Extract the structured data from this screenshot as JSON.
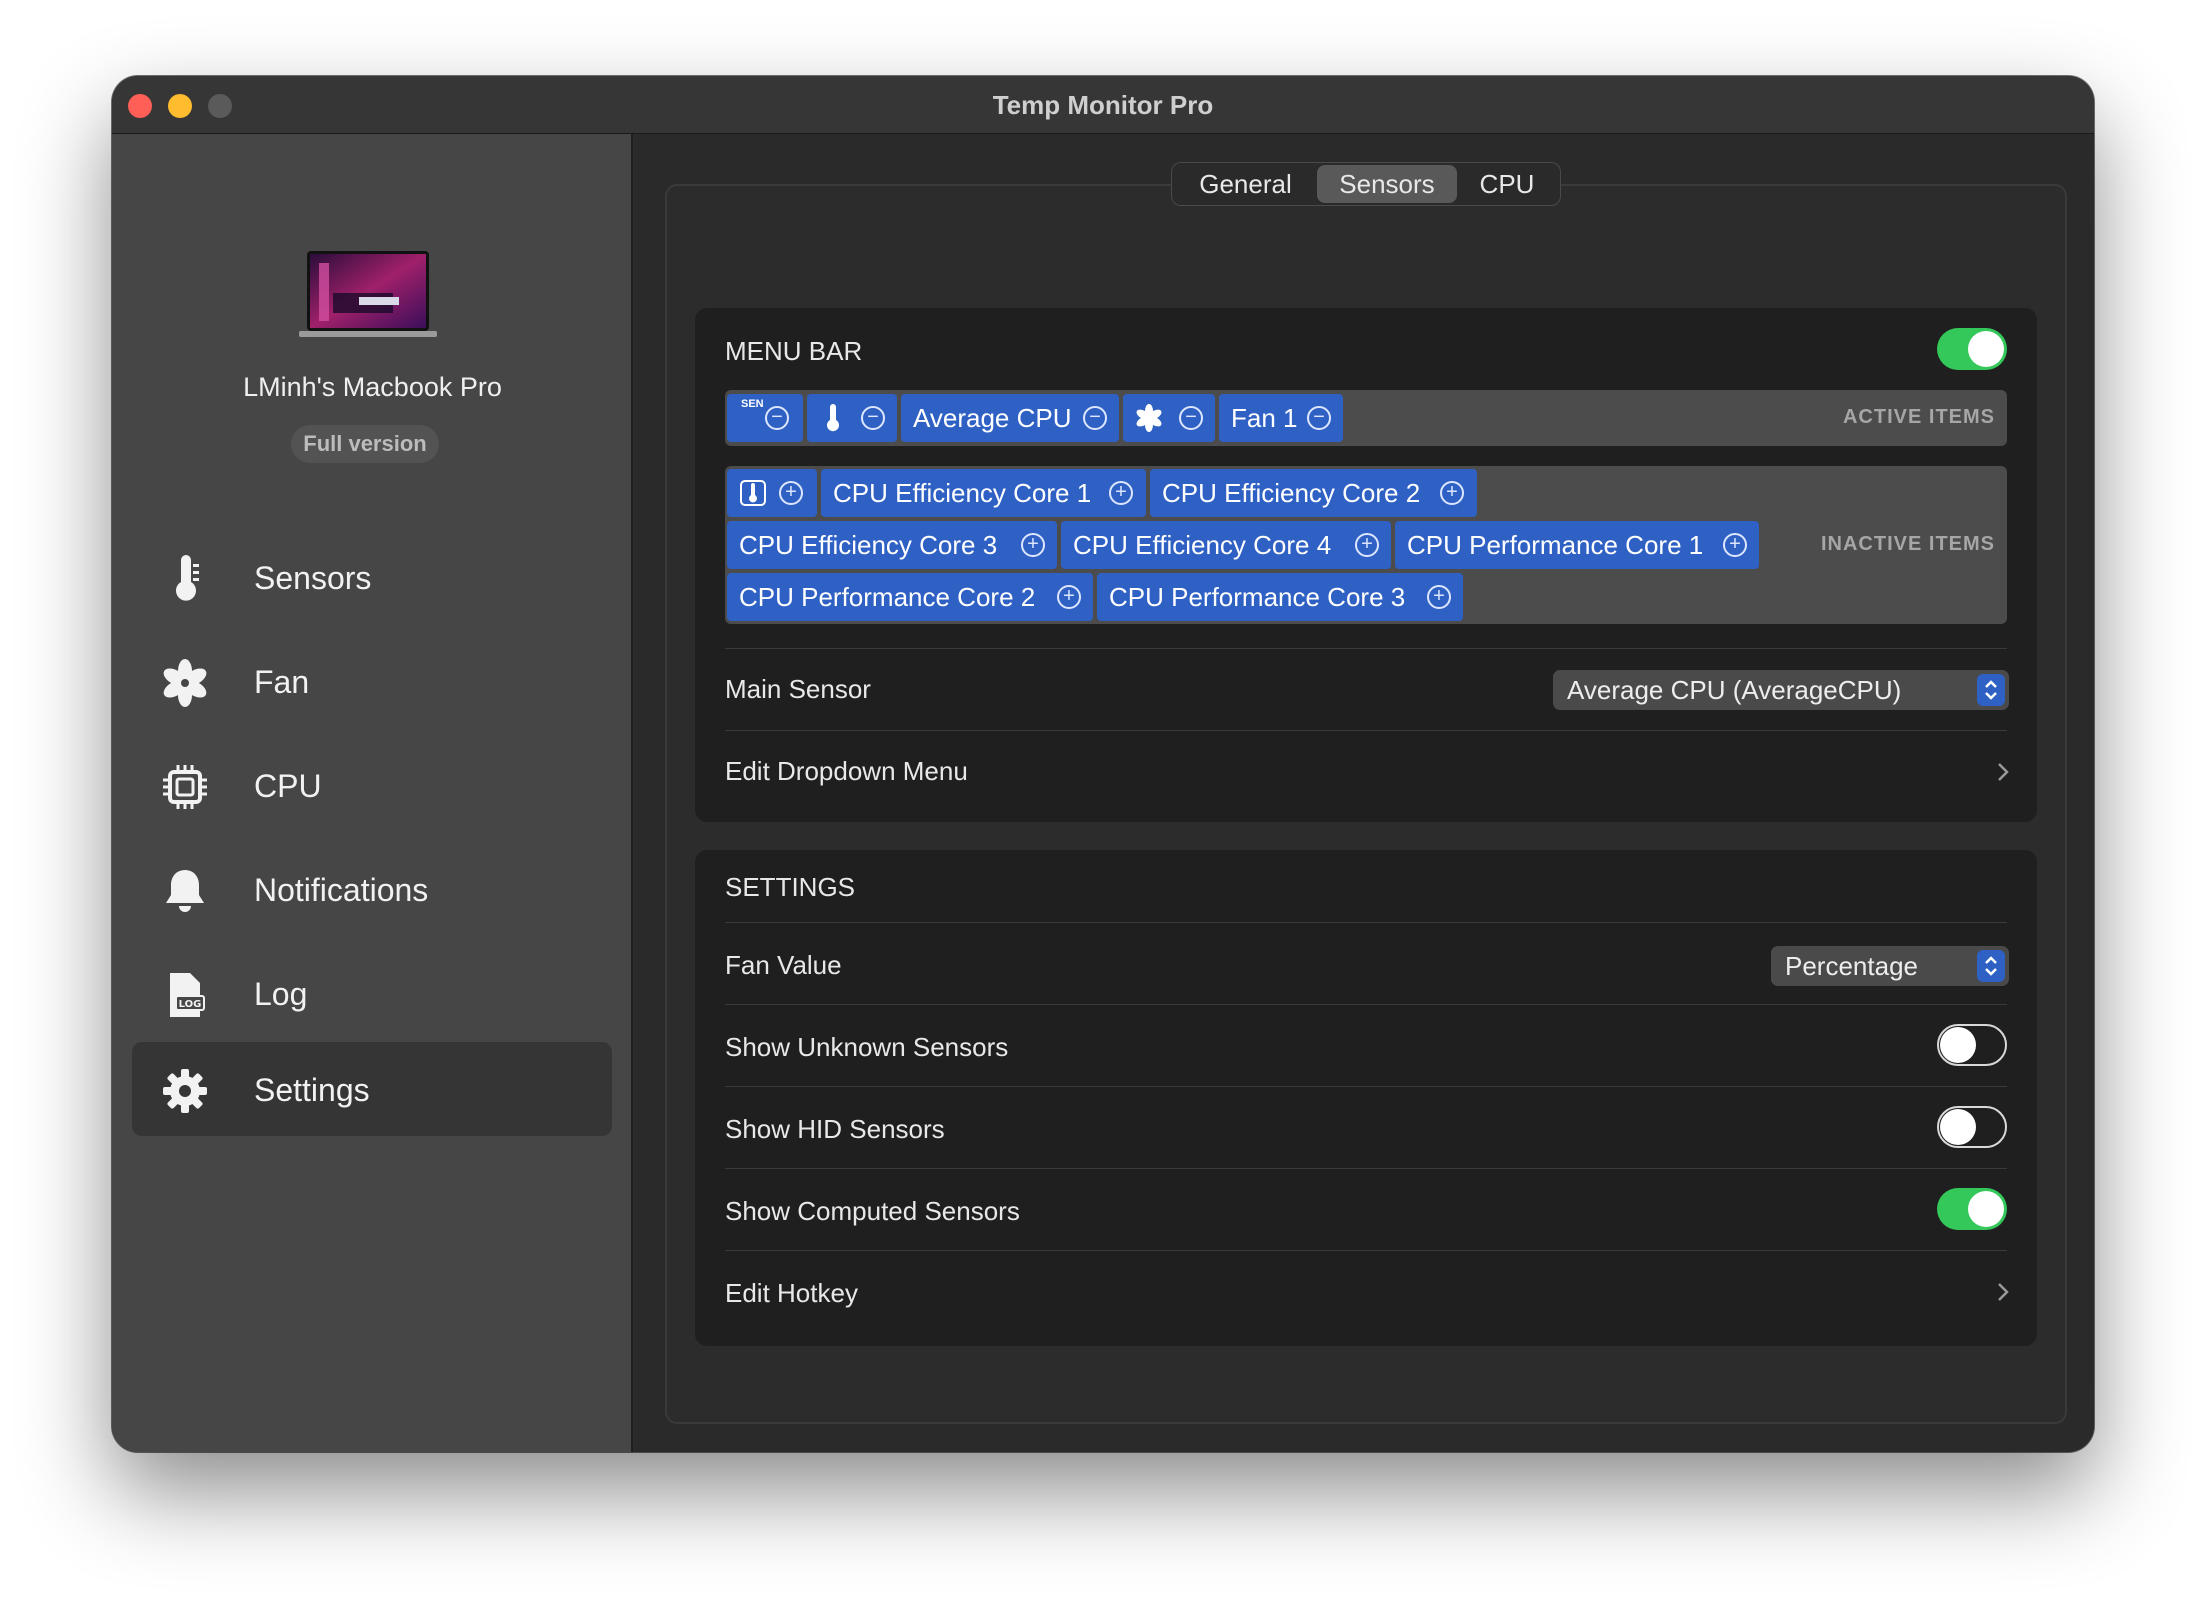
{
  "window": {
    "title": "Temp Monitor Pro"
  },
  "sidebar": {
    "device_name": "LMinh's Macbook Pro",
    "version_badge": "Full version",
    "items": [
      {
        "label": "Sensors",
        "icon": "thermometer-icon"
      },
      {
        "label": "Fan",
        "icon": "fan-icon"
      },
      {
        "label": "CPU",
        "icon": "cpu-icon"
      },
      {
        "label": "Notifications",
        "icon": "bell-icon"
      },
      {
        "label": "Log",
        "icon": "log-file-icon"
      },
      {
        "label": "Settings",
        "icon": "gear-icon",
        "active": true
      }
    ]
  },
  "tabs": [
    {
      "label": "General"
    },
    {
      "label": "Sensors",
      "active": true
    },
    {
      "label": "CPU"
    }
  ],
  "menu_bar": {
    "title": "MENU BAR",
    "enabled": true,
    "active_label": "ACTIVE ITEMS",
    "inactive_label": "INACTIVE ITEMS",
    "active_items": {
      "sen_icon_text": "SEN",
      "average_cpu": "Average CPU",
      "fan1": "Fan 1"
    },
    "inactive_items": [
      "CPU Efficiency Core 1",
      "CPU Efficiency Core 2",
      "CPU Efficiency Core 3",
      "CPU Efficiency Core 4",
      "CPU Performance Core 1",
      "CPU Performance Core 2",
      "CPU Performance Core 3"
    ],
    "main_sensor_label": "Main Sensor",
    "main_sensor_value": "Average CPU (AverageCPU)",
    "edit_dropdown_label": "Edit Dropdown Menu"
  },
  "settings": {
    "title": "SETTINGS",
    "fan_value_label": "Fan Value",
    "fan_value_value": "Percentage",
    "show_unknown_label": "Show Unknown Sensors",
    "show_unknown": false,
    "show_hid_label": "Show HID Sensors",
    "show_hid": false,
    "show_computed_label": "Show Computed Sensors",
    "show_computed": true,
    "edit_hotkey_label": "Edit Hotkey"
  },
  "colors": {
    "accent_blue": "#2f61c4",
    "toggle_on": "#34c759",
    "close": "#ff5f57",
    "minimize": "#febc2e"
  }
}
